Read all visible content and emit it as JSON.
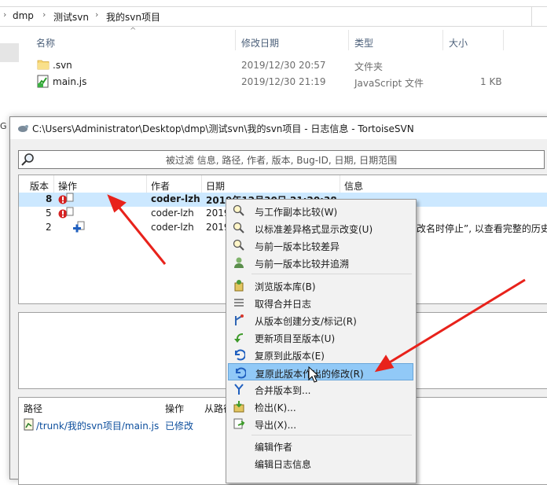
{
  "explorer": {
    "breadcrumb": [
      "dmp",
      "测试svn",
      "我的svn项目"
    ],
    "columns": {
      "name": "名称",
      "date": "修改日期",
      "type": "类型",
      "size": "大小"
    },
    "files": [
      {
        "name": ".svn",
        "date": "2019/12/30 20:57",
        "type": "文件夹",
        "size": ""
      },
      {
        "name": "main.js",
        "date": "2019/12/30 21:19",
        "type": "JavaScript 文件",
        "size": "1 KB"
      }
    ],
    "left_fragment": "G"
  },
  "svn_window": {
    "title": "C:\\Users\\Administrator\\Desktop\\dmp\\测试svn\\我的svn项目 - 日志信息 - TortoiseSVN",
    "filter_placeholder": "被过滤 信息, 路径, 作者, 版本, Bug-ID, 日期, 日期范围",
    "log_columns": {
      "revision": "版本",
      "actions": "操作",
      "author": "作者",
      "date": "日期",
      "message": "信息"
    },
    "log_rows": [
      {
        "revision": "8",
        "author": "coder-lzh",
        "date": "2019年12月30日 21:20:38",
        "message": ""
      },
      {
        "revision": "5",
        "author": "coder-lzh",
        "date": "2019",
        "message": ""
      },
      {
        "revision": "2",
        "author": "coder-lzh",
        "date": "2019",
        "message": "改名时停止”, 以查看完整的历史另"
      }
    ],
    "path_columns": {
      "path": "路径",
      "action": "操作",
      "from_path": "从路径"
    },
    "path_rows": [
      {
        "path": "/trunk/我的svn项目/main.js",
        "action": "已修改"
      }
    ]
  },
  "context_menu": {
    "items": [
      {
        "label": "与工作副本比较(W)",
        "icon": "magnifier-compare-icon"
      },
      {
        "label": "以标准差异格式显示改变(U)",
        "icon": "magnifier-diff-icon"
      },
      {
        "label": "与前一版本比较差异",
        "icon": "magnifier-prev-icon"
      },
      {
        "label": "与前一版本比较并追溯",
        "icon": "blame-user-icon"
      },
      {
        "label": "浏览版本库(B)",
        "icon": "repo-browser-icon"
      },
      {
        "label": "取得合并日志",
        "icon": "merge-log-icon"
      },
      {
        "label": "从版本创建分支/标记(R)",
        "icon": "branch-icon"
      },
      {
        "label": "更新项目至版本(U)",
        "icon": "update-arrow-icon"
      },
      {
        "label": "复原到此版本(E)",
        "icon": "revert-to-icon"
      },
      {
        "label": "复原此版本作出的修改(R)",
        "icon": "revert-changes-icon",
        "highlighted": true
      },
      {
        "label": "合并版本到...",
        "icon": "merge-down-icon"
      },
      {
        "label": "检出(K)...",
        "icon": "checkout-icon"
      },
      {
        "label": "导出(X)...",
        "icon": "export-icon"
      },
      {
        "label": "编辑作者",
        "icon": ""
      },
      {
        "label": "编辑日志信息",
        "icon": ""
      }
    ]
  },
  "colors": {
    "selected_row": "#cce8ff",
    "menu_highlight": "#91c9f7",
    "annotation_arrow": "#e8221b",
    "link_blue": "#0b4d9c"
  }
}
